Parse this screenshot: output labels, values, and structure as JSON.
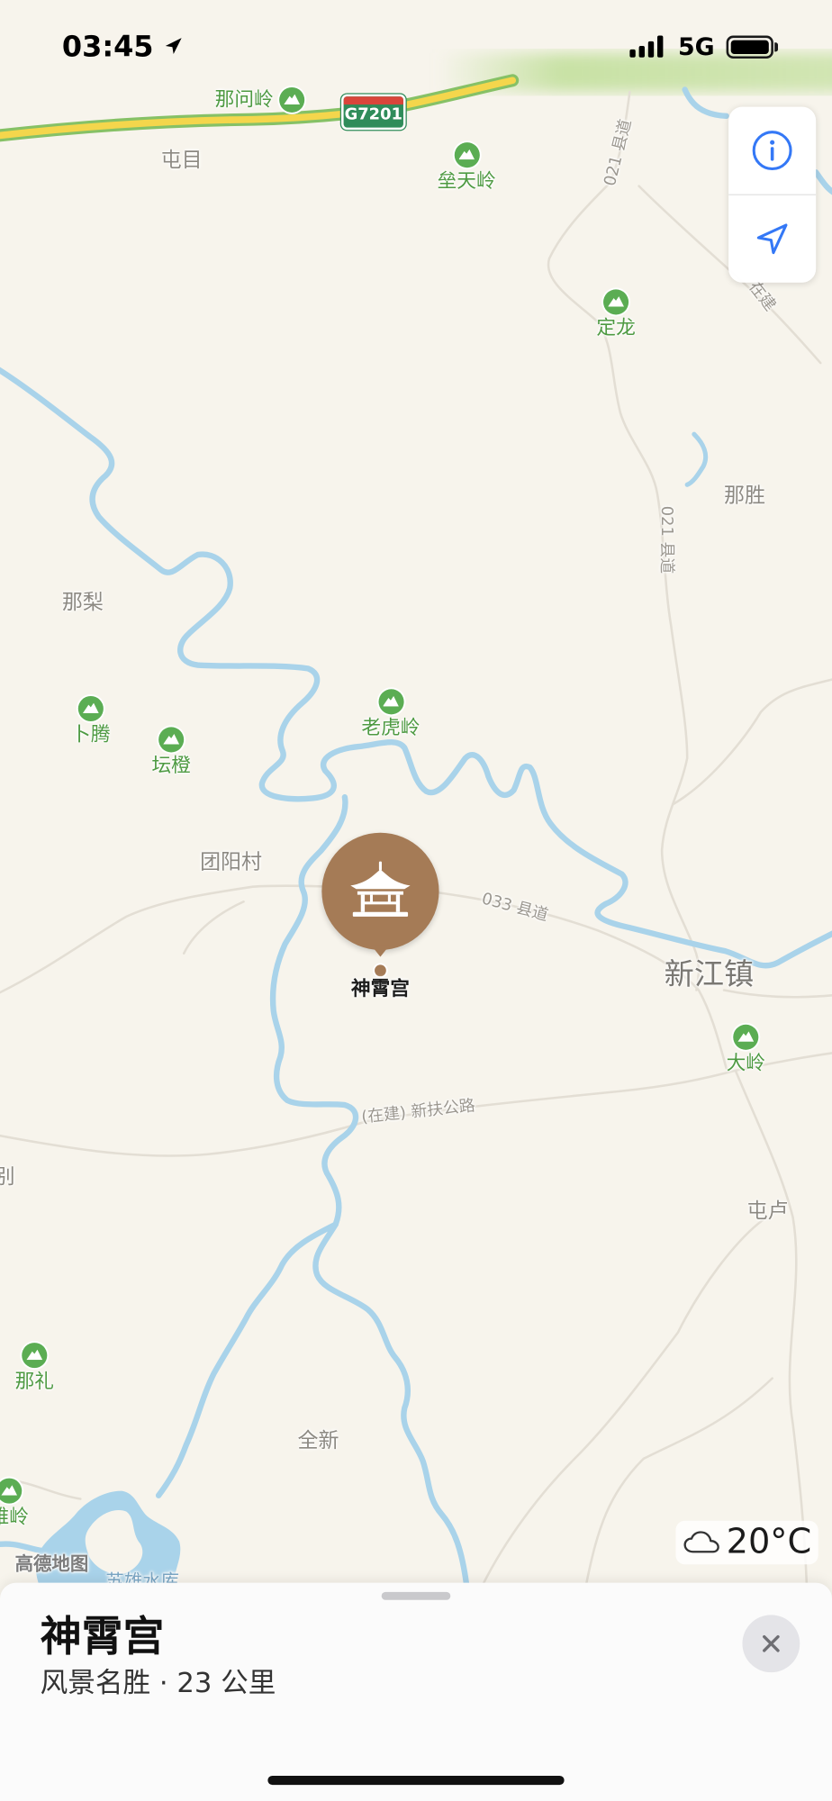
{
  "status_bar": {
    "time": "03:45",
    "network": "5G",
    "icons": [
      "location-arrow-icon",
      "signal-bars-icon",
      "battery-icon"
    ]
  },
  "map": {
    "highway_shield": "G7201",
    "peaks": [
      "那问岭",
      "垒天岭",
      "定龙",
      "卜腾",
      "坛橙",
      "老虎岭",
      "大岭",
      "那礼",
      "雉岭"
    ],
    "places": [
      "屯目",
      "那胜",
      "那梨",
      "团阳村",
      "屯卢",
      "全新",
      "别"
    ],
    "town": "新江镇",
    "roads": [
      "021 县道",
      "021 县道",
      "033 县道",
      "(在建) 新扶公路",
      "在建"
    ],
    "water": [
      "苏雄水库"
    ],
    "attribution": "高德地图",
    "colors": {
      "land": "#f7f4ec",
      "water": "#a9d3ea",
      "peak": "#4e9a42",
      "highway": "#f4d64c",
      "road": "#e3ded4"
    }
  },
  "map_controls": {
    "info_icon": "info-icon",
    "locate_icon": "location-arrow-icon"
  },
  "weather": {
    "icon": "cloud-icon",
    "temperature": "20°C"
  },
  "selected_pin": {
    "icon": "pavilion-icon",
    "label": "神霄宫",
    "color": "#a57b56"
  },
  "place_sheet": {
    "title": "神霄宫",
    "subtitle": "风景名胜 · 23 公里",
    "close_icon": "close-icon"
  }
}
